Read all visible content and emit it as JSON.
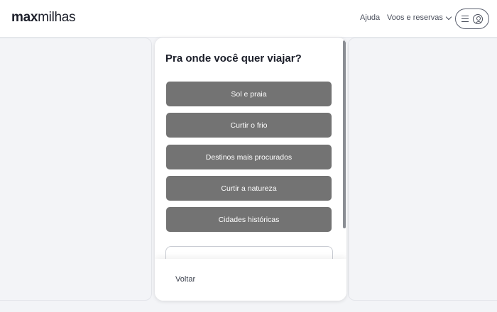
{
  "header": {
    "logo_bold": "max",
    "logo_light": "milhas",
    "help_label": "Ajuda",
    "trips_label": "Voos e reservas"
  },
  "modal": {
    "title": "Pra onde você quer viajar?",
    "options": [
      {
        "label": "Sol e praia"
      },
      {
        "label": "Curtir o frio"
      },
      {
        "label": "Destinos mais procurados"
      },
      {
        "label": "Curtir a natureza"
      },
      {
        "label": "Cidades históricas"
      }
    ],
    "back_label": "Voltar"
  },
  "colors": {
    "option_bg": "#737373",
    "page_bg": "#f3f4f7",
    "title_text": "#1c1f2a"
  },
  "icons": {
    "trips_dropdown": "chevron-down-icon",
    "menu": "hamburger-icon",
    "account": "user-icon"
  }
}
